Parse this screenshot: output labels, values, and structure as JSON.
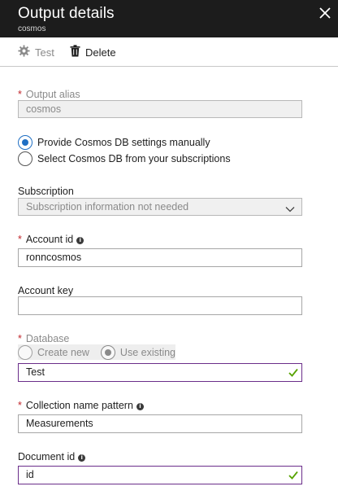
{
  "header": {
    "title": "Output details",
    "subtitle": "cosmos"
  },
  "toolbar": {
    "test_label": "Test",
    "delete_label": "Delete"
  },
  "output_alias": {
    "label": "Output alias",
    "value": "cosmos"
  },
  "cosmos_source": {
    "options": [
      {
        "label": "Provide Cosmos DB settings manually",
        "selected": true
      },
      {
        "label": "Select Cosmos DB from your subscriptions",
        "selected": false
      }
    ]
  },
  "subscription": {
    "label": "Subscription",
    "value": "Subscription information not needed"
  },
  "account_id": {
    "label": "Account id",
    "value": "ronncosmos"
  },
  "account_key": {
    "label": "Account key",
    "value": ""
  },
  "database": {
    "label": "Database",
    "create_new_label": "Create new",
    "use_existing_label": "Use existing",
    "value": "Test"
  },
  "collection": {
    "label": "Collection name pattern",
    "value": "Measurements"
  },
  "document_id": {
    "label": "Document id",
    "value": "id"
  },
  "colors": {
    "header_bg": "#1c1c1c",
    "required": "#c1272d",
    "radio_selected": "#1f6fc4",
    "valid_border": "#6b2e8a",
    "valid_check": "#57a300"
  },
  "icons": [
    "close-icon",
    "gear-icon",
    "trash-icon",
    "info-icon",
    "chevron-down-icon",
    "checkmark-icon"
  ]
}
